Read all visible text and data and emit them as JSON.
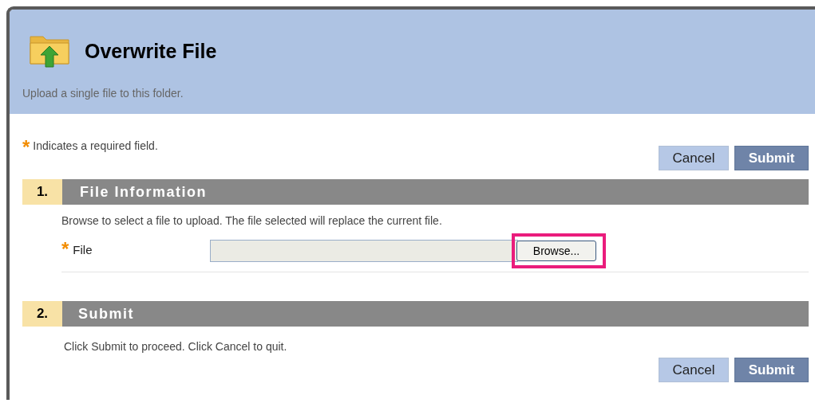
{
  "header": {
    "title": "Overwrite File",
    "subtitle": "Upload a single file to this folder."
  },
  "required_note": {
    "marker": "*",
    "text": "Indicates a required field."
  },
  "top_buttons": [
    {
      "label": "Cancel",
      "kind": "secondary"
    },
    {
      "label": "Submit",
      "kind": "primary"
    }
  ],
  "sections": [
    {
      "number": "1.",
      "title": "File Information",
      "instructions": "Browse to select a file to upload. The file selected will replace the current file.",
      "field": {
        "marker": "*",
        "label": "File",
        "browse_label": "Browse...",
        "highlighted": true
      }
    },
    {
      "number": "2.",
      "title": "Submit",
      "instructions": "Click Submit to proceed. Click Cancel to quit.",
      "buttons": [
        {
          "label": "Cancel",
          "kind": "secondary"
        },
        {
          "label": "Submit",
          "kind": "primary"
        }
      ]
    }
  ]
}
